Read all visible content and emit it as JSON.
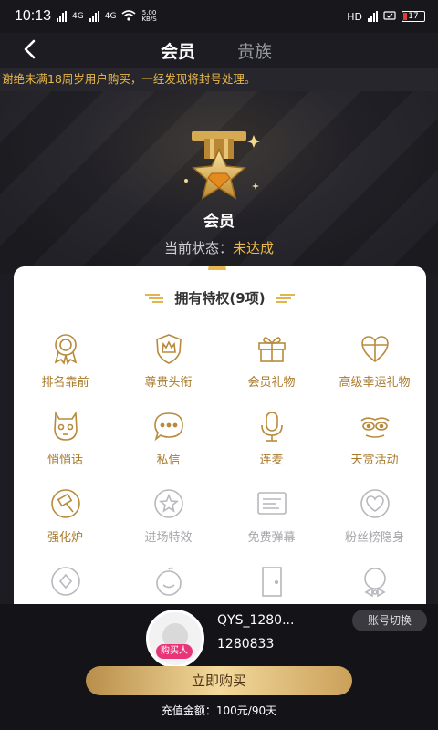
{
  "status_bar": {
    "time": "10:13",
    "signal1": "4G",
    "signal2": "4G",
    "net_speed_value": "5.00",
    "net_speed_unit": "KB/S",
    "hd": "HD",
    "battery": "17"
  },
  "header": {
    "tabs": [
      {
        "label": "会员"
      },
      {
        "label": "贵族"
      }
    ]
  },
  "notice": {
    "text": "谢绝未满18周岁用户购买，一经发现将封号处理。"
  },
  "hero": {
    "title": "会员",
    "status_label": "当前状态：",
    "status_value": "未达成"
  },
  "privileges": {
    "title": "拥有特权(9项)",
    "items": [
      {
        "label": "排名靠前",
        "icon": "medal-icon",
        "active": true
      },
      {
        "label": "尊贵头衔",
        "icon": "crown-shield-icon",
        "active": true
      },
      {
        "label": "会员礼物",
        "icon": "gift-box-icon",
        "active": true
      },
      {
        "label": "高级幸运礼物",
        "icon": "heart-gift-icon",
        "active": true
      },
      {
        "label": "悄悄话",
        "icon": "whisper-icon",
        "active": true
      },
      {
        "label": "私信",
        "icon": "message-bubble-icon",
        "active": true
      },
      {
        "label": "连麦",
        "icon": "microphone-icon",
        "active": true
      },
      {
        "label": "天赏活动",
        "icon": "mask-icon",
        "active": true
      },
      {
        "label": "强化炉",
        "icon": "hammer-icon",
        "active": true
      },
      {
        "label": "进场特效",
        "icon": "star-circle-icon",
        "active": false
      },
      {
        "label": "免费弹幕",
        "icon": "barrage-icon",
        "active": false
      },
      {
        "label": "粉丝榜隐身",
        "icon": "heart-hidden-icon",
        "active": false
      },
      {
        "label": "",
        "icon": "coin-icon",
        "active": false
      },
      {
        "label": "",
        "icon": "face-icon",
        "active": false
      },
      {
        "label": "",
        "icon": "door-icon",
        "active": false
      },
      {
        "label": "",
        "icon": "bowtie-icon",
        "active": false
      }
    ]
  },
  "user": {
    "name": "QYS_1280...",
    "id": "1280833",
    "buyer_tag": "购买人",
    "switch_label": "账号切换"
  },
  "purchase": {
    "button_label": "立即购买",
    "recharge_label": "充值金额：",
    "recharge_value": "100元/90天"
  },
  "colors": {
    "gold": "#e9b94a",
    "icon_gold": "#a97a2c",
    "disabled": "#a6a6ab",
    "background": "#1c1c22"
  }
}
